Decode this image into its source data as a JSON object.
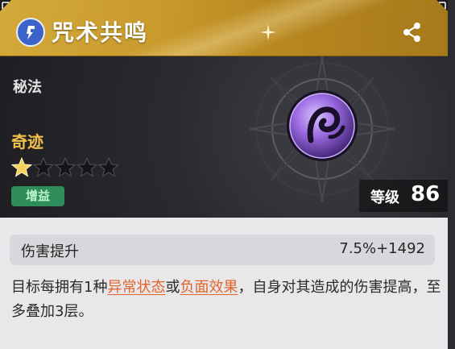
{
  "header": {
    "title": "咒术共鸣",
    "badge_icon": "spell-scroll-icon",
    "share_icon": "share-icon"
  },
  "banner": {
    "category": "秘法",
    "rarity": "奇迹",
    "stars": {
      "filled": 1,
      "total": 5
    },
    "tag": "增益",
    "level_label": "等级",
    "level_value": "86",
    "emblem_icon": "purple-swirl-orb-icon"
  },
  "stat": {
    "label": "伤害提升",
    "value": "7.5%+1492"
  },
  "description": {
    "part1": "目标每拥有1种",
    "keyword1": "异常状态",
    "part2": "或",
    "keyword2": "负面效果",
    "part3": "，自身对其造成的伤害提高，至多叠加3层。"
  },
  "colors": {
    "header_gold": "#c99a2c",
    "rarity": "#f2c14e",
    "tag_green": "#2e8d5a",
    "keyword_orange": "#e0652a",
    "emblem_purple": "#8a5ad8"
  }
}
